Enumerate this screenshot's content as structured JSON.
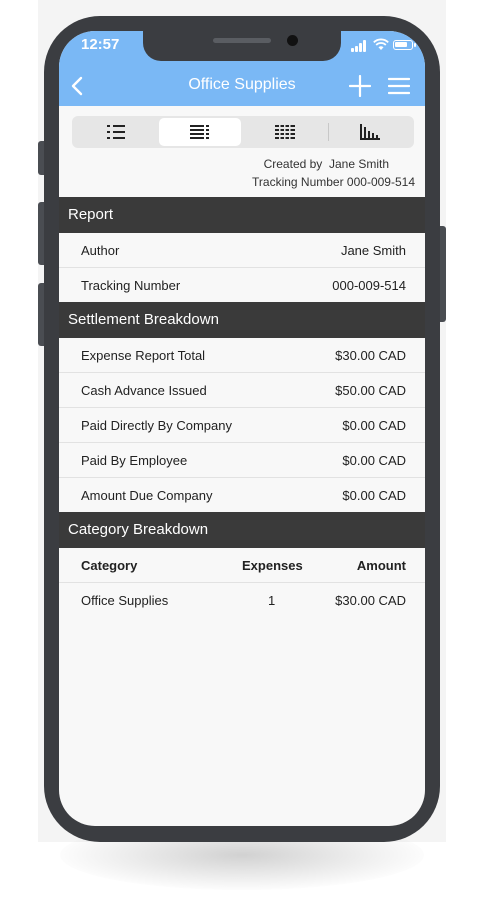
{
  "status_bar": {
    "time": "12:57"
  },
  "nav": {
    "title": "Office Supplies"
  },
  "meta": {
    "created_by_label": "Created by",
    "created_by_name": "Jane Smith",
    "tracking_line": "Tracking Number 000-009-514"
  },
  "report": {
    "title": "Report",
    "rows": [
      {
        "label": "Author",
        "value": "Jane Smith"
      },
      {
        "label": "Tracking Number",
        "value": "000-009-514"
      }
    ]
  },
  "settlement": {
    "title": "Settlement Breakdown",
    "rows": [
      {
        "label": "Expense Report Total",
        "value": "$30.00 CAD"
      },
      {
        "label": "Cash Advance Issued",
        "value": "$50.00 CAD"
      },
      {
        "label": "Paid Directly By Company",
        "value": "$0.00 CAD"
      },
      {
        "label": "Paid By Employee",
        "value": "$0.00 CAD"
      },
      {
        "label": "Amount Due Company",
        "value": "$0.00 CAD"
      }
    ]
  },
  "category": {
    "title": "Category Breakdown",
    "headers": {
      "category": "Category",
      "expenses": "Expenses",
      "amount": "Amount"
    },
    "rows": [
      {
        "category": "Office Supplies",
        "expenses": "1",
        "amount": "$30.00 CAD"
      }
    ]
  },
  "colors": {
    "accent": "#7ab8f5",
    "section_header": "#3a3a3a",
    "phone_frame": "#3b3d41"
  },
  "icons": [
    "back-icon",
    "plus-icon",
    "menu-icon",
    "list-view-icon",
    "detail-view-icon",
    "grid-view-icon",
    "chart-view-icon",
    "signal-icon",
    "wifi-icon",
    "battery-icon"
  ]
}
